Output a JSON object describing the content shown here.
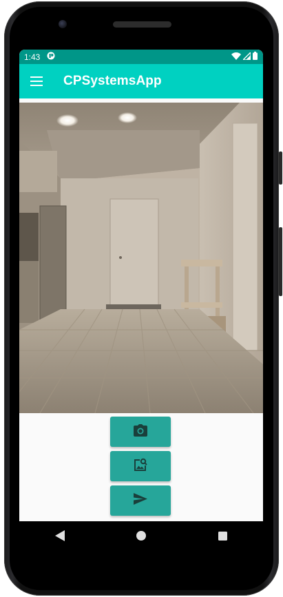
{
  "status_bar": {
    "time": "1:43",
    "color": "#009688",
    "icons": [
      "notification-app-icon",
      "wifi-icon",
      "signal-icon",
      "battery-icon"
    ]
  },
  "app_bar": {
    "title": "CPSystemsApp",
    "menu_icon": "hamburger-menu-icon",
    "color": "#00d1c1"
  },
  "photo": {
    "description_icon": "preview-image"
  },
  "actions": {
    "color": "#26a69a",
    "buttons": [
      {
        "icon": "camera-icon"
      },
      {
        "icon": "image-search-icon"
      },
      {
        "icon": "send-icon"
      }
    ]
  },
  "nav_bar": {
    "icons": [
      "back-icon",
      "home-icon",
      "recents-icon"
    ]
  }
}
